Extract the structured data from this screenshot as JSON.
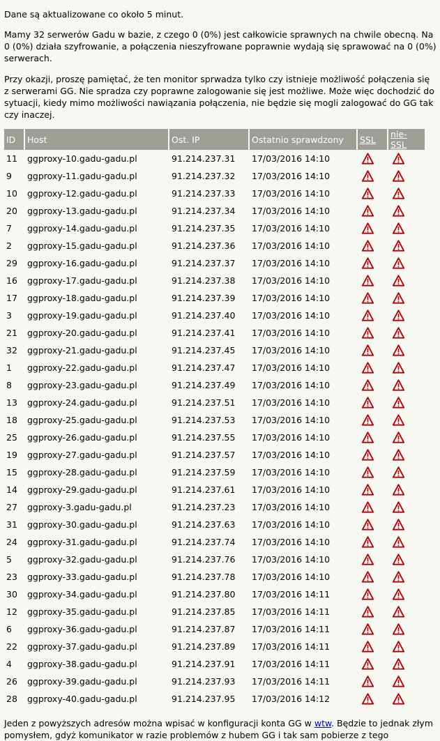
{
  "notice": "Dane są aktualizowane co około 5 minut.",
  "summary": "Mamy 32 serwerów Gadu w bazie, z czego 0 (0%) jest całkowicie sprawnych na chwile obecną. Na 0 (0%) działa szyfrowanie, a połączenia nieszyfrowane poprawnie wydają się sprawować na 0 (0%) serwerach.",
  "disclaimer": "Przy okazji, proszę pamiętać, że ten monitor sprwadza tylko czy istnieje możliwość połączenia się z serwerami GG. Nie spradza czy poprawne zalogowanie się jest możliwe. Może więc dochodzić do sytuacji, kiedy mimo możliwości nawiązania połączenia, nie będzie się mogli zalogować do GG tak czy inaczej.",
  "table": {
    "headers": [
      "ID",
      "Host",
      "Ost. IP",
      "Ostatnio sprawdzony",
      "SSL",
      "nie-SSL"
    ],
    "status_icon": "warning-icon",
    "status_color": "#b00000",
    "rows": [
      [
        "11",
        "ggproxy-10.gadu-gadu.pl",
        "91.214.237.31",
        "17/03/2016 14:10"
      ],
      [
        "9",
        "ggproxy-11.gadu-gadu.pl",
        "91.214.237.32",
        "17/03/2016 14:10"
      ],
      [
        "10",
        "ggproxy-12.gadu-gadu.pl",
        "91.214.237.33",
        "17/03/2016 14:10"
      ],
      [
        "20",
        "ggproxy-13.gadu-gadu.pl",
        "91.214.237.34",
        "17/03/2016 14:10"
      ],
      [
        "7",
        "ggproxy-14.gadu-gadu.pl",
        "91.214.237.35",
        "17/03/2016 14:10"
      ],
      [
        "2",
        "ggproxy-15.gadu-gadu.pl",
        "91.214.237.36",
        "17/03/2016 14:10"
      ],
      [
        "29",
        "ggproxy-16.gadu-gadu.pl",
        "91.214.237.37",
        "17/03/2016 14:10"
      ],
      [
        "16",
        "ggproxy-17.gadu-gadu.pl",
        "91.214.237.38",
        "17/03/2016 14:10"
      ],
      [
        "17",
        "ggproxy-18.gadu-gadu.pl",
        "91.214.237.39",
        "17/03/2016 14:10"
      ],
      [
        "3",
        "ggproxy-19.gadu-gadu.pl",
        "91.214.237.40",
        "17/03/2016 14:10"
      ],
      [
        "21",
        "ggproxy-20.gadu-gadu.pl",
        "91.214.237.41",
        "17/03/2016 14:10"
      ],
      [
        "32",
        "ggproxy-21.gadu-gadu.pl",
        "91.214.237.45",
        "17/03/2016 14:10"
      ],
      [
        "1",
        "ggproxy-22.gadu-gadu.pl",
        "91.214.237.47",
        "17/03/2016 14:10"
      ],
      [
        "8",
        "ggproxy-23.gadu-gadu.pl",
        "91.214.237.49",
        "17/03/2016 14:10"
      ],
      [
        "13",
        "ggproxy-24.gadu-gadu.pl",
        "91.214.237.51",
        "17/03/2016 14:10"
      ],
      [
        "18",
        "ggproxy-25.gadu-gadu.pl",
        "91.214.237.53",
        "17/03/2016 14:10"
      ],
      [
        "25",
        "ggproxy-26.gadu-gadu.pl",
        "91.214.237.55",
        "17/03/2016 14:10"
      ],
      [
        "19",
        "ggproxy-27.gadu-gadu.pl",
        "91.214.237.57",
        "17/03/2016 14:10"
      ],
      [
        "15",
        "ggproxy-28.gadu-gadu.pl",
        "91.214.237.59",
        "17/03/2016 14:10"
      ],
      [
        "14",
        "ggproxy-29.gadu-gadu.pl",
        "91.214.237.61",
        "17/03/2016 14:10"
      ],
      [
        "27",
        "ggproxy-3.gadu-gadu.pl",
        "91.214.237.23",
        "17/03/2016 14:10"
      ],
      [
        "31",
        "ggproxy-30.gadu-gadu.pl",
        "91.214.237.63",
        "17/03/2016 14:10"
      ],
      [
        "24",
        "ggproxy-31.gadu-gadu.pl",
        "91.214.237.74",
        "17/03/2016 14:10"
      ],
      [
        "5",
        "ggproxy-32.gadu-gadu.pl",
        "91.214.237.76",
        "17/03/2016 14:10"
      ],
      [
        "23",
        "ggproxy-33.gadu-gadu.pl",
        "91.214.237.78",
        "17/03/2016 14:10"
      ],
      [
        "30",
        "ggproxy-34.gadu-gadu.pl",
        "91.214.237.80",
        "17/03/2016 14:11"
      ],
      [
        "12",
        "ggproxy-35.gadu-gadu.pl",
        "91.214.237.85",
        "17/03/2016 14:11"
      ],
      [
        "6",
        "ggproxy-36.gadu-gadu.pl",
        "91.214.237.87",
        "17/03/2016 14:11"
      ],
      [
        "22",
        "ggproxy-37.gadu-gadu.pl",
        "91.214.237.89",
        "17/03/2016 14:11"
      ],
      [
        "4",
        "ggproxy-38.gadu-gadu.pl",
        "91.214.237.91",
        "17/03/2016 14:11"
      ],
      [
        "26",
        "ggproxy-39.gadu-gadu.pl",
        "91.214.237.93",
        "17/03/2016 14:11"
      ],
      [
        "28",
        "ggproxy-40.gadu-gadu.pl",
        "91.214.237.95",
        "17/03/2016 14:12"
      ]
    ]
  },
  "footer": {
    "before_link": "Jeden z powyższych adresów można wpisać w konfiguracji konta GG w ",
    "link": "wtw",
    "after_link": ". Będzie to jednak złym pomysłem, gdyż komunikator w razie problemów z hubem GG i tak sam pobierze z tego"
  }
}
